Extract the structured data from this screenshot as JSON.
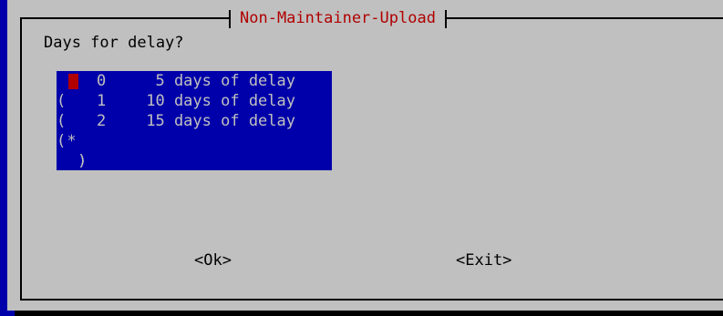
{
  "dialog": {
    "title": "Non-Maintainer-Upload",
    "prompt": "Days for delay?"
  },
  "options": [
    {
      "mark": " ",
      "tag": "0",
      "label": "  5 days of delay",
      "selected": false,
      "focused": true
    },
    {
      "mark": "*",
      "tag": "1",
      "label": " 10 days of delay",
      "selected": true,
      "focused": false
    },
    {
      "mark": " ",
      "tag": "2",
      "label": " 15 days of delay",
      "selected": false,
      "focused": false
    }
  ],
  "buttons": {
    "ok_label": "<Ok>",
    "exit_label": "<Exit>"
  },
  "colors": {
    "background": "#0000aa",
    "dialog": "#c0c0c0",
    "title": "#b00000",
    "list_bg": "#0000aa",
    "list_text": "#c0c0c0",
    "cursor": "#b00000"
  }
}
